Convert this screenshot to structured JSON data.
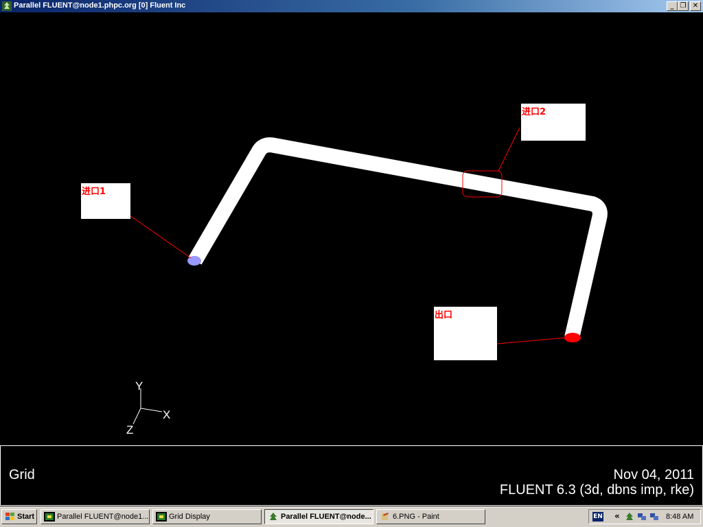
{
  "window": {
    "title": "Parallel FLUENT@node1.phpc.org [0] Fluent Inc",
    "min_symbol": "_",
    "max_symbol": "❐",
    "close_symbol": "✕"
  },
  "viewport": {
    "labels": {
      "inlet1": "进口1",
      "inlet2": "进口2",
      "outlet": "出口"
    },
    "axes": {
      "y": "Y",
      "x": "X",
      "z": "Z"
    },
    "colors": {
      "pipe": "#ffffff",
      "inlet1_face": "#9999ff",
      "outlet_face": "#ff0000",
      "leader": "#ff0000"
    }
  },
  "infobar": {
    "display_name": "Grid",
    "date": "Nov 04, 2011",
    "version": "FLUENT 6.3 (3d, dbns imp, rke)"
  },
  "taskbar": {
    "start_label": "Start",
    "items": [
      {
        "label": "Parallel FLUENT@node1....",
        "icon": "fluent-icon"
      },
      {
        "label": "Grid Display",
        "icon": "fluent-icon"
      },
      {
        "label": "Parallel FLUENT@node...",
        "icon": "fluent-tree-icon"
      },
      {
        "label": "6.PNG - Paint",
        "icon": "paint-icon"
      }
    ],
    "tray": {
      "lang": "EN",
      "chevron": "«",
      "clock": "8:48 AM"
    }
  }
}
